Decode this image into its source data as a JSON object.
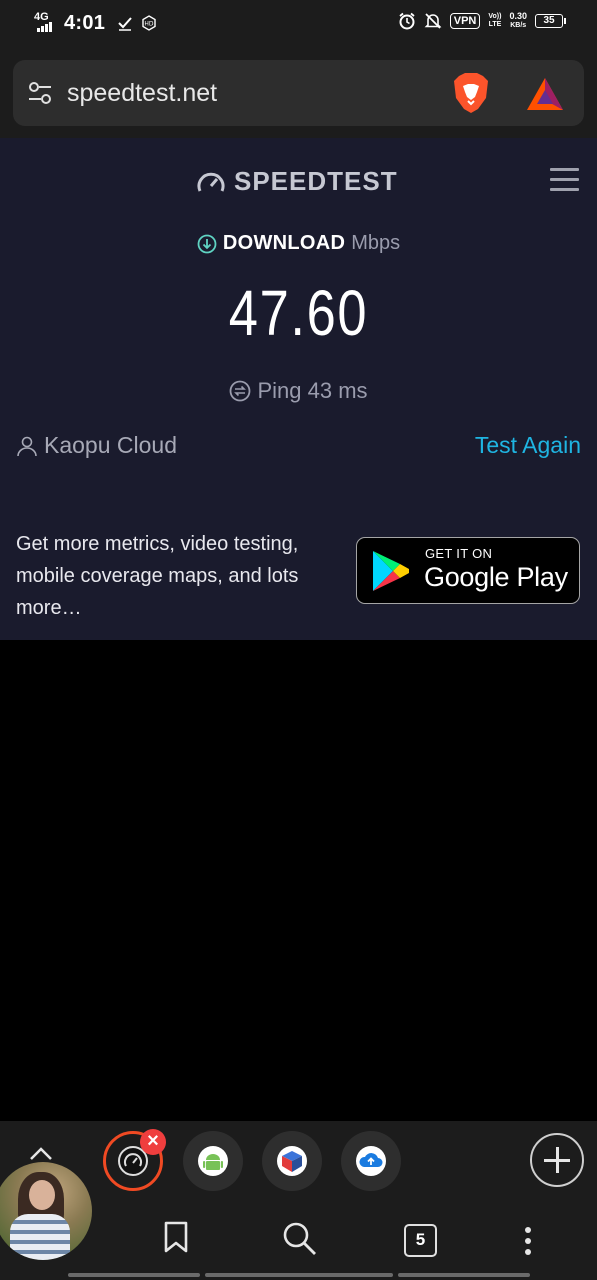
{
  "status_bar": {
    "network": "4G",
    "time": "4:01",
    "vpn": "VPN",
    "volte_top": "Vo))",
    "volte_bottom": "LTE",
    "speed_value": "0.30",
    "speed_unit": "KB/s",
    "battery": "35"
  },
  "browser": {
    "url": "speedtest.net",
    "tab_count": "5"
  },
  "speedtest": {
    "logo_text": "SPEEDTEST",
    "metric_label": "DOWNLOAD",
    "metric_unit": "Mbps",
    "speed_value": "47.60",
    "ping_label": "Ping 43 ms",
    "provider": "Kaopu Cloud",
    "test_again": "Test Again",
    "promo_text": "Get more metrics, video testing, mobile coverage maps, and lots more…",
    "gplay_small": "GET IT ON",
    "gplay_big": "Google Play"
  },
  "colors": {
    "page_bg": "#1a1b2d",
    "accent": "#1fb5e2",
    "active_tab_ring": "#f04a23",
    "close_badge": "#ef3e3e"
  },
  "icons": {
    "status_bar": [
      "signal-icon",
      "check-icon",
      "hd-icon",
      "alarm-icon",
      "mute-bell-icon"
    ],
    "address_bar": [
      "tune-icon",
      "brave-lion-icon",
      "bat-icon"
    ],
    "speedtest": [
      "speedometer-icon",
      "download-arrow-icon",
      "ping-icon",
      "user-icon",
      "google-play-icon"
    ],
    "tab_strip": [
      "speedometer-icon",
      "android-icon",
      "vpn-cube-icon",
      "cloud-upload-icon"
    ],
    "toolbar": [
      "chevron-up-icon",
      "bookmark-icon",
      "search-icon",
      "more-vert-icon",
      "plus-icon"
    ]
  }
}
